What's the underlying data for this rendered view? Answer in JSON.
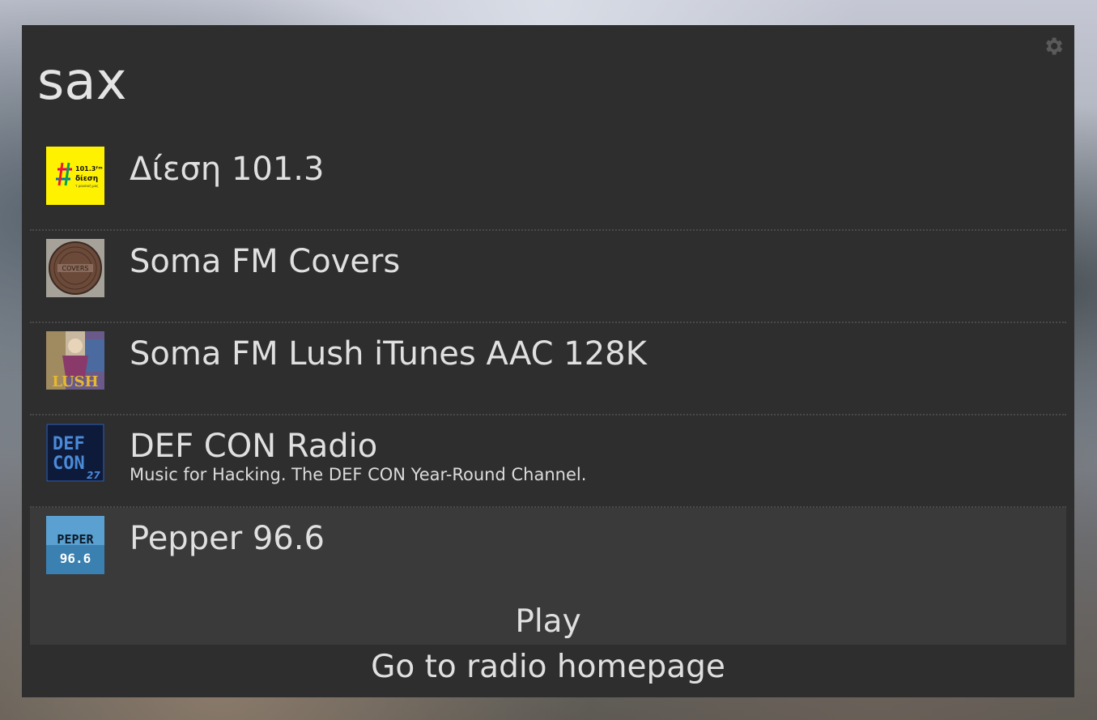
{
  "search": {
    "query": "sax"
  },
  "settings": {
    "icon": "gear-icon"
  },
  "results": [
    {
      "name": "Δίεση 101.3",
      "description": "",
      "logo": "diesi-logo",
      "logo_text": "101.3 δίεση"
    },
    {
      "name": "Soma FM Covers",
      "description": "",
      "logo": "soma-covers-logo",
      "logo_text": "COVERS"
    },
    {
      "name": "Soma FM Lush iTunes AAC 128K",
      "description": "",
      "logo": "soma-lush-logo",
      "logo_text": "LUSH"
    },
    {
      "name": "DEF CON Radio",
      "description": "Music for Hacking. The DEF CON Year-Round Channel.",
      "logo": "defcon-logo",
      "logo_text": "DEF CON 27"
    },
    {
      "name": "Pepper 96.6",
      "description": "",
      "logo": "pepper-logo",
      "logo_text": "PEPPER 96.6"
    }
  ],
  "selected_index": 4,
  "actions": {
    "play": "Play",
    "homepage": "Go to radio homepage"
  },
  "colors": {
    "panel": "#2e2e2e",
    "selected": "#3a3a3a",
    "text": "#e0e0e0"
  }
}
